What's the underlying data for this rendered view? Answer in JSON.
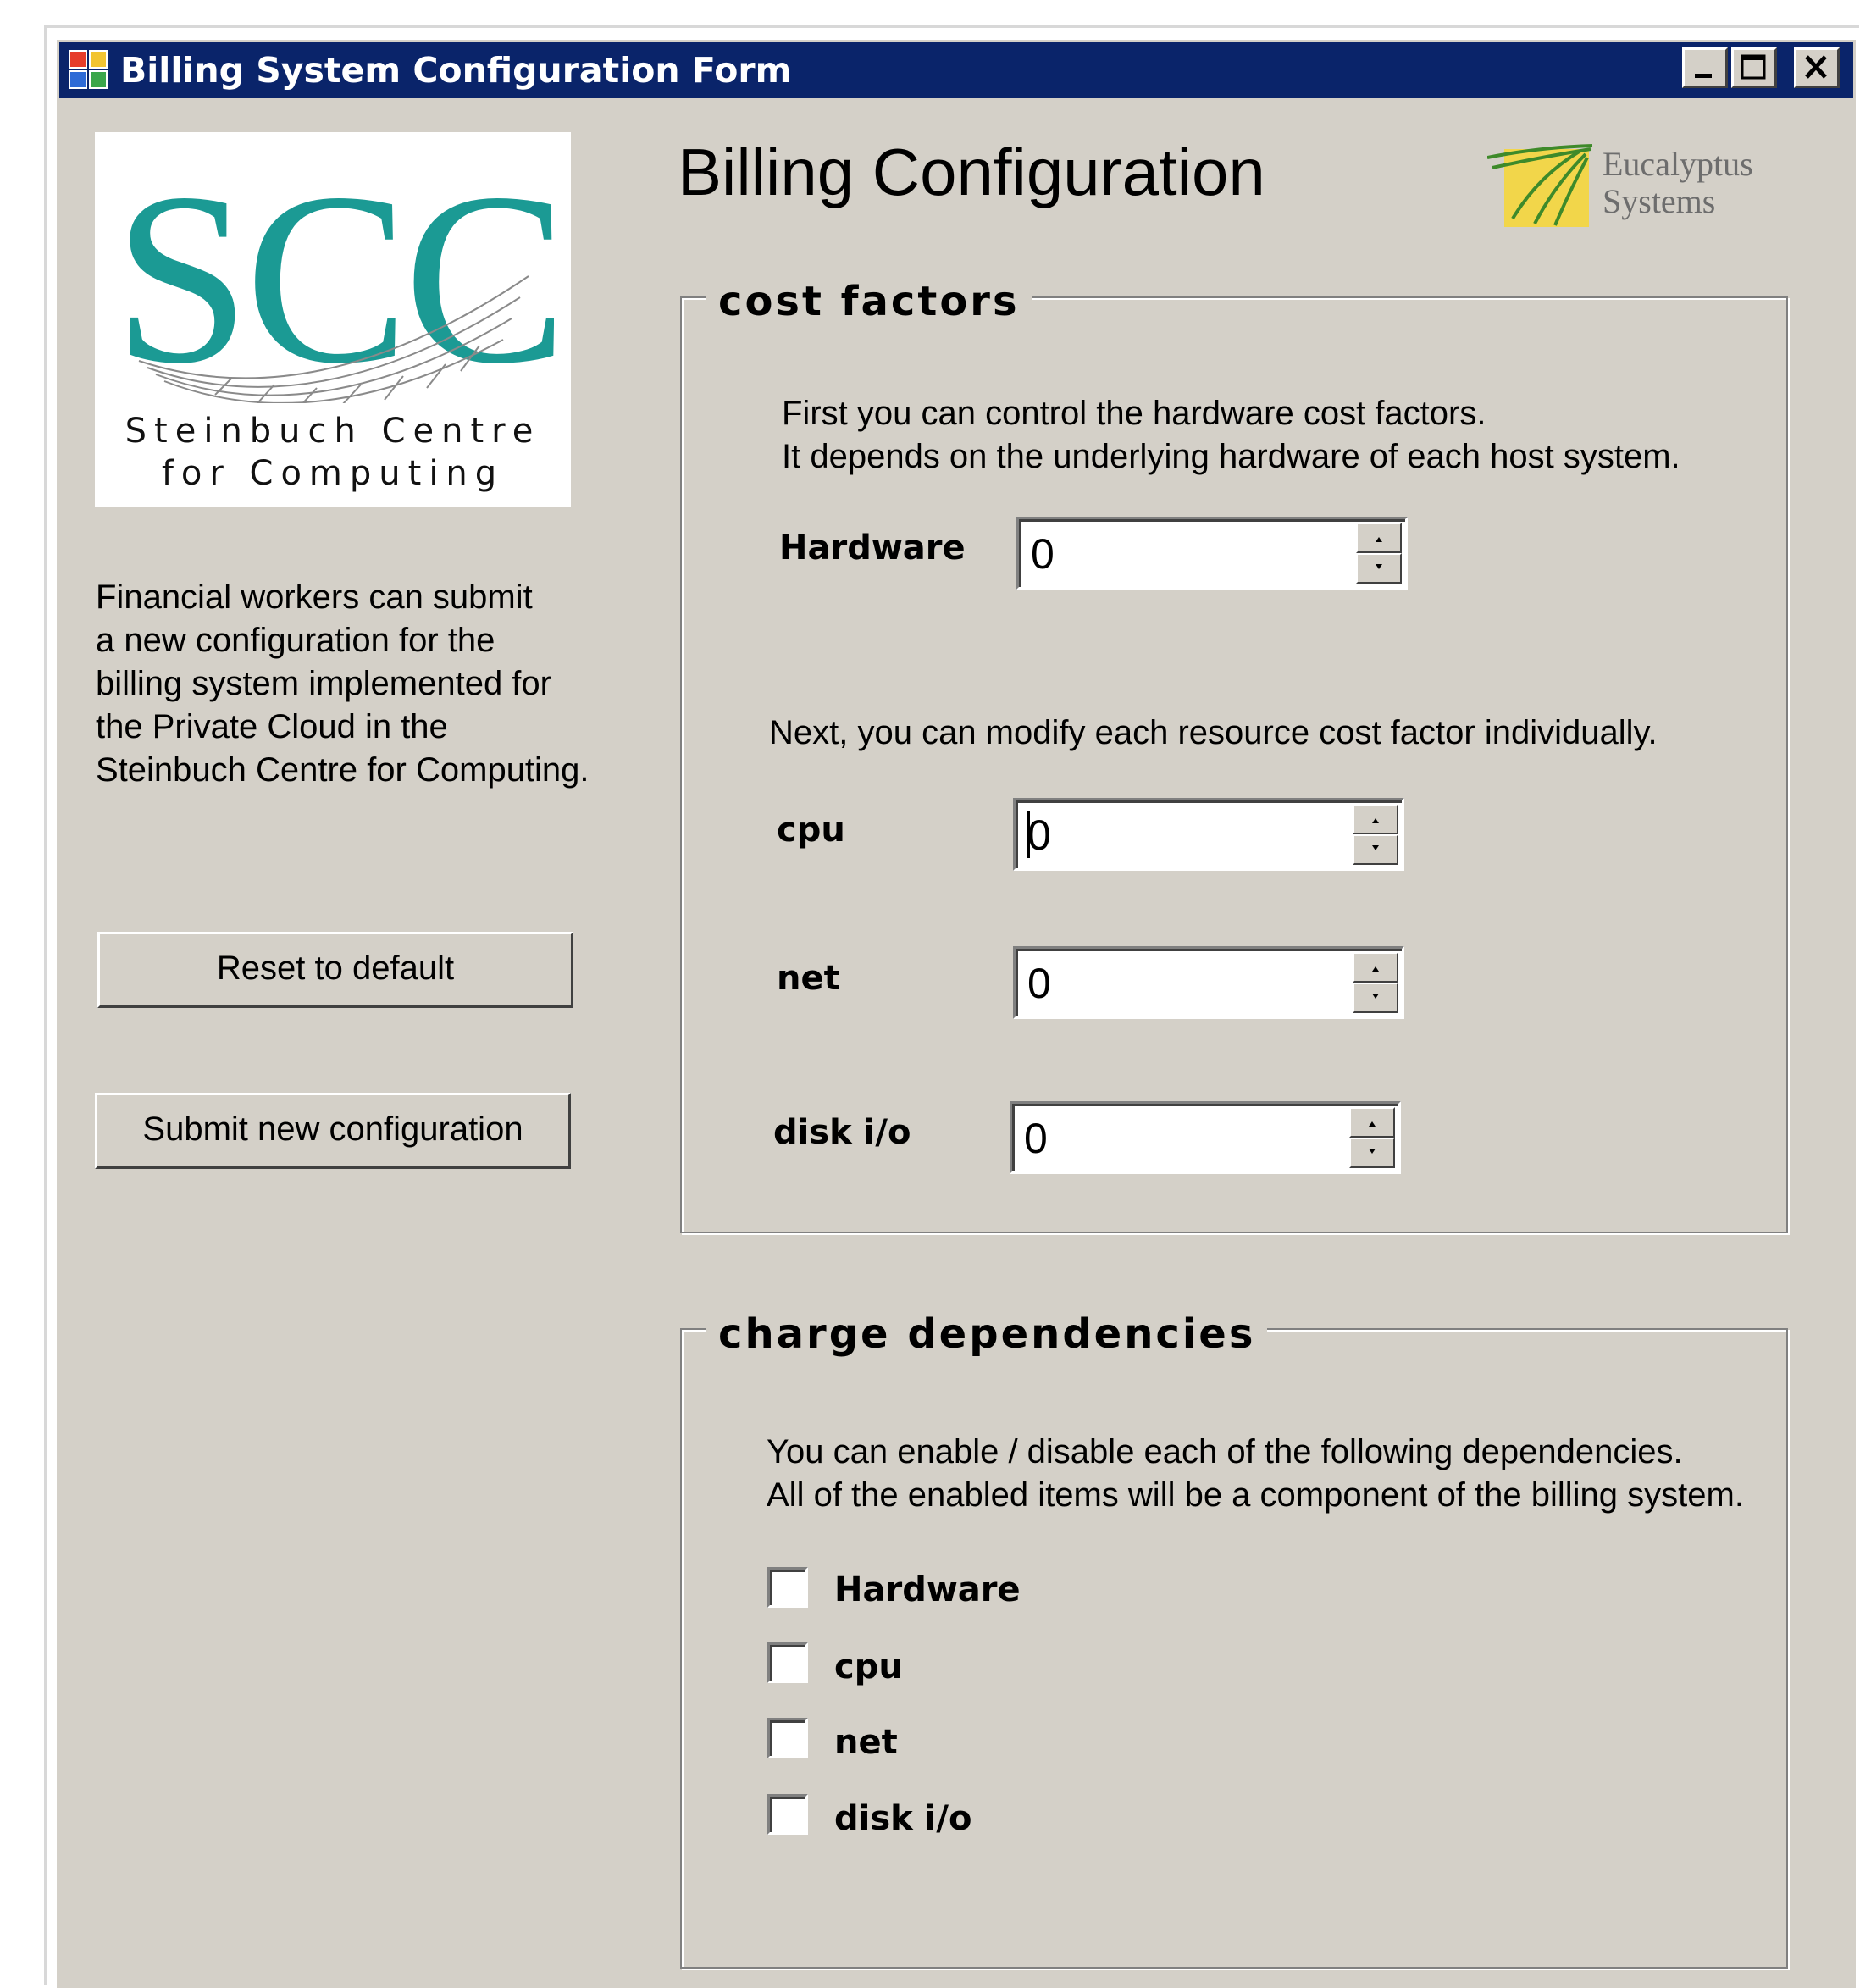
{
  "window": {
    "title": "Billing System Configuration Form",
    "icons": [
      "app-icon",
      "minimize-icon",
      "maximize-icon",
      "close-icon"
    ]
  },
  "logos": {
    "scc_mark": "SCC",
    "scc_line1": "Steinbuch Centre",
    "scc_line2": "for Computing",
    "eucalyptus_line1": "Eucalyptus",
    "eucalyptus_line2": "Systems"
  },
  "sidebar": {
    "description_lines": [
      "Financial workers can submit",
      "a new configuration for the",
      "billing system implemented for",
      "the Private Cloud in the",
      "Steinbuch Centre for Computing."
    ],
    "reset_label": "Reset to default",
    "submit_label": "Submit new configuration"
  },
  "main": {
    "title": "Billing Configuration",
    "cost_factors": {
      "legend": "cost factors",
      "intro_line1": "First you can control the hardware cost factors.",
      "intro_line2": "It depends on the underlying hardware of each host system.",
      "hardware_label": "Hardware",
      "hardware_value": "0",
      "next_text": "Next, you can modify each resource cost factor individually.",
      "cpu_label": "cpu",
      "cpu_value": "0",
      "net_label": "net",
      "net_value": "0",
      "disk_label": "disk i/o",
      "disk_value": "0"
    },
    "charge_dependencies": {
      "legend": "charge dependencies",
      "intro_line1": "You can enable / disable each of the following dependencies.",
      "intro_line2": "All of the enabled items will be a component of the billing system.",
      "items": [
        {
          "label": "Hardware",
          "checked": false
        },
        {
          "label": "cpu",
          "checked": false
        },
        {
          "label": "net",
          "checked": false
        },
        {
          "label": "disk i/o",
          "checked": false
        }
      ]
    }
  },
  "colors": {
    "titlebar": "#0a246a",
    "face": "#d4d0c8",
    "scc_teal": "#1b9a94",
    "euca_yellow": "#f2d64a"
  }
}
